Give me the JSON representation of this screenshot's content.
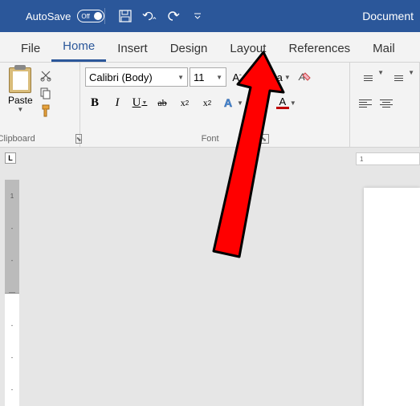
{
  "titlebar": {
    "autosave_label": "AutoSave",
    "autosave_state": "Off",
    "document_title": "Document"
  },
  "tabs": [
    {
      "label": "File",
      "active": false
    },
    {
      "label": "Home",
      "active": true
    },
    {
      "label": "Insert",
      "active": false
    },
    {
      "label": "Design",
      "active": false
    },
    {
      "label": "Layout",
      "active": false
    },
    {
      "label": "References",
      "active": false
    },
    {
      "label": "Mail",
      "active": false
    }
  ],
  "ribbon": {
    "clipboard": {
      "paste_label": "Paste",
      "group_label": "Clipboard"
    },
    "font": {
      "name": "Calibri (Body)",
      "size": "11",
      "increase": "A˄",
      "decrease": "A˅",
      "case": "Aa",
      "group_label": "Font"
    }
  },
  "hruler_text": "1",
  "vruler_marks": [
    "1",
    "-",
    "-",
    "—",
    "-",
    "-",
    "-"
  ],
  "annotation": {
    "target": "Layout tab"
  }
}
